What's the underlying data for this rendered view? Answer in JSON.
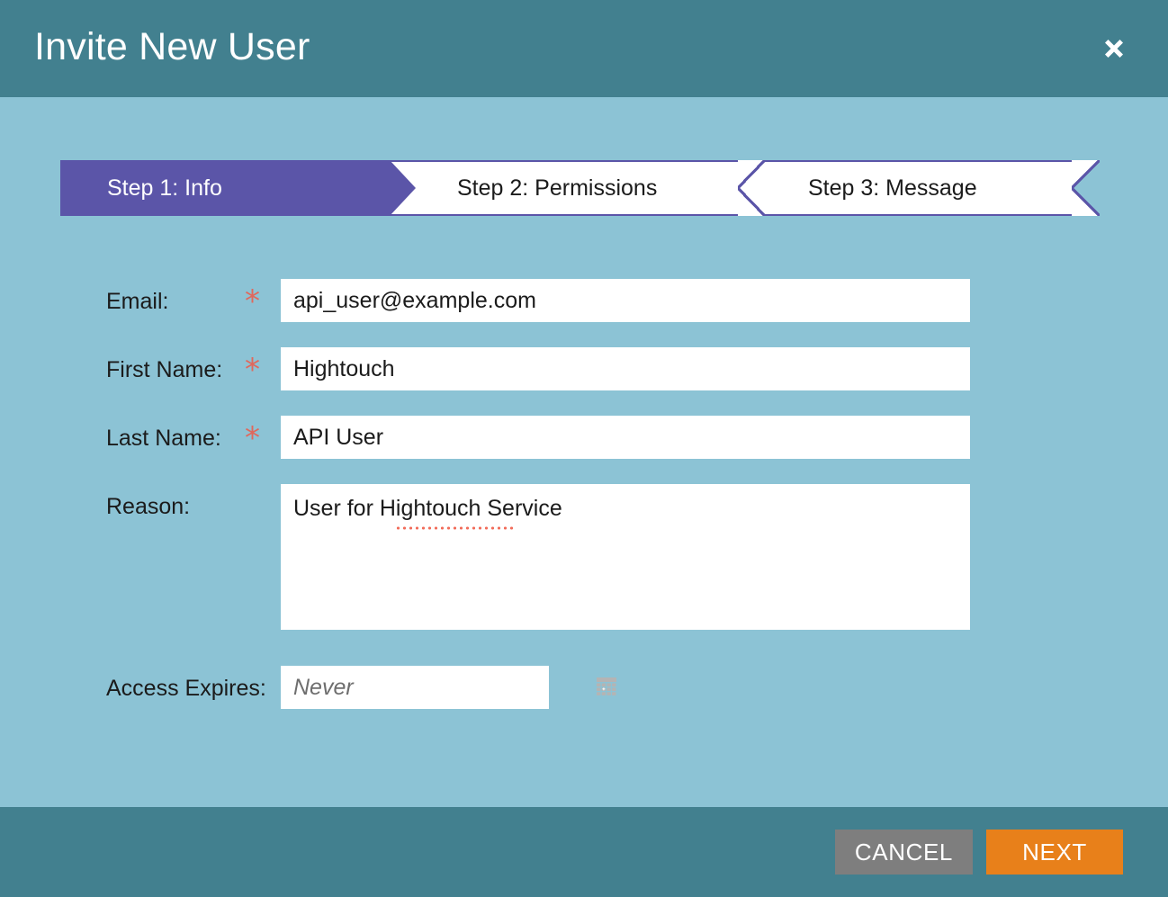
{
  "theme": {
    "header_bg": "#42808F",
    "body_bg": "#8CC3D5",
    "accent_purple": "#5B55A8",
    "required_star": "#E0685C",
    "primary_button": "#E8801A",
    "secondary_button": "#7E7E7E",
    "spellcheck_underline": "#F26D5B"
  },
  "header": {
    "title": "Invite New User",
    "close_label": "✖",
    "close_icon": "close-icon"
  },
  "wizard": {
    "steps": [
      {
        "label": "Step 1: Info",
        "active": true
      },
      {
        "label": "Step 2: Permissions",
        "active": false
      },
      {
        "label": "Step 3: Message",
        "active": false
      }
    ]
  },
  "form": {
    "email": {
      "label": "Email:",
      "required_marker": "*",
      "value": "api_user@example.com",
      "placeholder": ""
    },
    "first_name": {
      "label": "First Name:",
      "required_marker": "*",
      "value": "Hightouch",
      "placeholder": ""
    },
    "last_name": {
      "label": "Last Name:",
      "required_marker": "*",
      "value": "API User",
      "placeholder": ""
    },
    "reason": {
      "label": "Reason:",
      "value": "User for Hightouch Service",
      "placeholder": "",
      "misspelled_word": "Hightouch"
    },
    "access_expires": {
      "label": "Access Expires:",
      "value": "",
      "placeholder": "Never",
      "calendar_icon": "calendar-icon"
    }
  },
  "footer": {
    "cancel_label": "CANCEL",
    "next_label": "NEXT"
  }
}
